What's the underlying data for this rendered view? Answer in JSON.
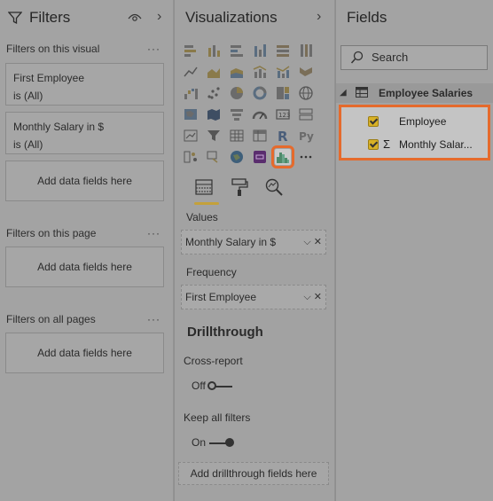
{
  "filters": {
    "title": "Filters",
    "section_visual": "Filters on this visual",
    "section_page": "Filters on this page",
    "section_all": "Filters on all pages",
    "more": "···",
    "cards": [
      {
        "name": "First Employee",
        "value": "is (All)"
      },
      {
        "name": "Monthly Salary in $",
        "value": "is (All)"
      }
    ],
    "add_data": "Add data fields here"
  },
  "visualizations": {
    "title": "Visualizations",
    "more": "···",
    "values_label": "Values",
    "values_field": "Monthly Salary in $",
    "frequency_label": "Frequency",
    "frequency_field": "First Employee",
    "drillthrough_title": "Drillthrough",
    "cross_report_label": "Cross-report",
    "cross_report_state": "Off",
    "keep_filters_label": "Keep all filters",
    "keep_filters_state": "On",
    "drill_add": "Add drillthrough fields here",
    "selected_visual_icon": "histogram-chart-icon"
  },
  "fields": {
    "title": "Fields",
    "search_placeholder": "Search",
    "table_name": "Employee Salaries",
    "items": [
      {
        "label": "Employee",
        "checked": true,
        "sigma": false
      },
      {
        "label": "Monthly Salar...",
        "checked": true,
        "sigma": true
      }
    ]
  },
  "colors": {
    "highlight": "#e56a2c",
    "checkbox": "#d8b126"
  }
}
